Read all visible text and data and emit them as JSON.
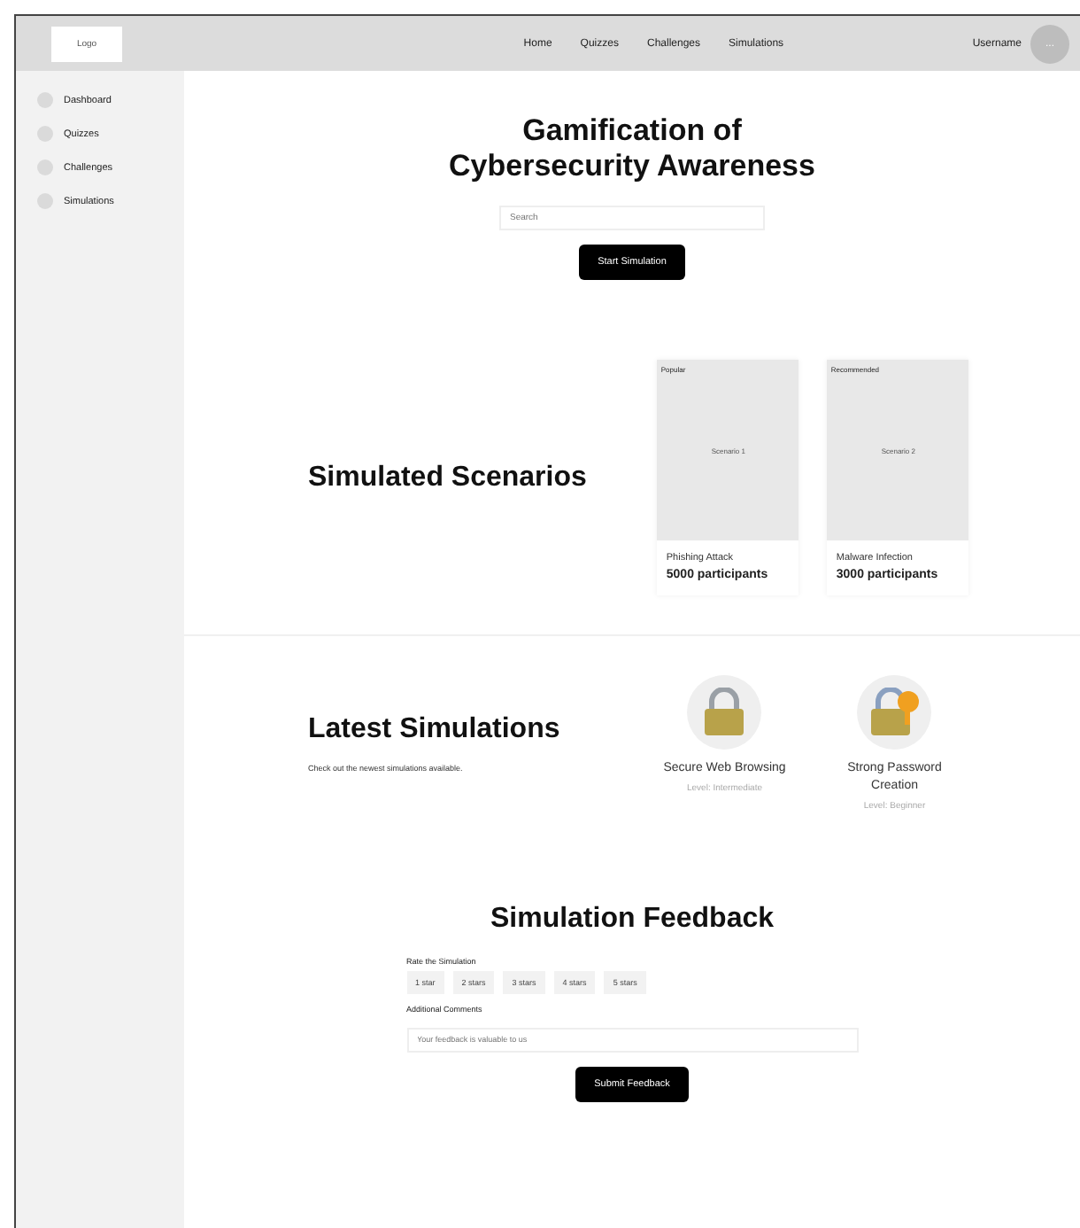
{
  "header": {
    "logo": "Logo",
    "nav": [
      "Home",
      "Quizzes",
      "Challenges",
      "Simulations"
    ],
    "username": "Username",
    "avatar": "..."
  },
  "sidebar": {
    "items": [
      "Dashboard",
      "Quizzes",
      "Challenges",
      "Simulations"
    ]
  },
  "hero": {
    "title_line1": "Gamification of",
    "title_line2": "Cybersecurity Awareness",
    "search": {
      "placeholder": "Search"
    },
    "button": "Start Simulation"
  },
  "scenarios": {
    "title": "Simulated Scenarios",
    "cards": [
      {
        "badge": "Popular",
        "image_label": "Scenario 1",
        "name": "Phishing Attack",
        "participants": "5000 participants"
      },
      {
        "badge": "Recommended",
        "image_label": "Scenario 2",
        "name": "Malware Infection",
        "participants": "3000 participants"
      }
    ]
  },
  "latest": {
    "title": "Latest Simulations",
    "subtitle": "Check out the newest simulations available.",
    "items": [
      {
        "kind": "lock",
        "title": "Secure Web Browsing",
        "level": "Level: Intermediate"
      },
      {
        "kind": "lock-key",
        "title": "Strong Password Creation",
        "level": "Level: Beginner"
      }
    ]
  },
  "feedback": {
    "title": "Simulation Feedback",
    "rate_label": "Rate the Simulation",
    "ratings": [
      "1 star",
      "2 stars",
      "3 stars",
      "4 stars",
      "5 stars"
    ],
    "comments_label": "Additional Comments",
    "comments": {
      "placeholder": "Your feedback is valuable to us"
    },
    "button": "Submit Feedback"
  }
}
